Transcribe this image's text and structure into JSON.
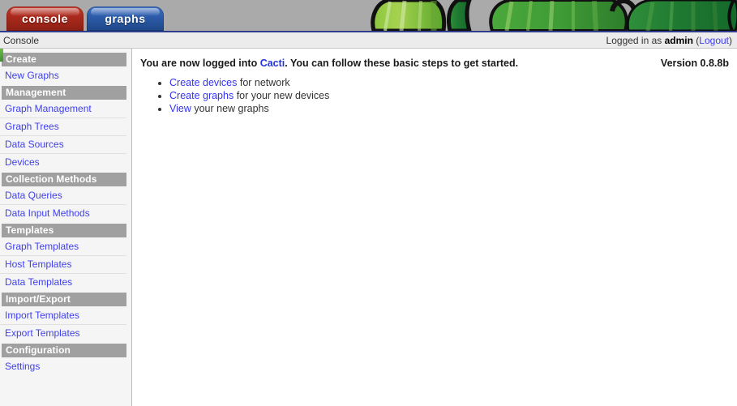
{
  "banner": {
    "art_name": "cacti-logo-banner",
    "background_color": "#aaaaaa"
  },
  "tabs": [
    {
      "id": "console",
      "label": "console",
      "color": "#a82a1d",
      "active": true
    },
    {
      "id": "graphs",
      "label": "graphs",
      "color": "#2b5ba8",
      "active": false
    }
  ],
  "topbar": {
    "breadcrumb": "Console",
    "logged_in_prefix": "Logged in as ",
    "username": "admin",
    "paren_open": " (",
    "logout_label": "Logout",
    "paren_close": ")"
  },
  "sidebar": {
    "sections": [
      {
        "header": "Create",
        "items": [
          {
            "label": "New Graphs",
            "last": true
          }
        ]
      },
      {
        "header": "Management",
        "items": [
          {
            "label": "Graph Management",
            "last": false
          },
          {
            "label": "Graph Trees",
            "last": false
          },
          {
            "label": "Data Sources",
            "last": false
          },
          {
            "label": "Devices",
            "last": true
          }
        ]
      },
      {
        "header": "Collection Methods",
        "items": [
          {
            "label": "Data Queries",
            "last": false
          },
          {
            "label": "Data Input Methods",
            "last": true
          }
        ]
      },
      {
        "header": "Templates",
        "items": [
          {
            "label": "Graph Templates",
            "last": false
          },
          {
            "label": "Host Templates",
            "last": false
          },
          {
            "label": "Data Templates",
            "last": true
          }
        ]
      },
      {
        "header": "Import/Export",
        "items": [
          {
            "label": "Import Templates",
            "last": false
          },
          {
            "label": "Export Templates",
            "last": true
          }
        ]
      },
      {
        "header": "Configuration",
        "items": [
          {
            "label": "Settings",
            "last": true
          }
        ]
      }
    ]
  },
  "main": {
    "welcome": {
      "part1": "You are now logged into ",
      "link": "Cacti",
      "part2": ". You can follow these basic steps to get started."
    },
    "version": "Version 0.8.8b",
    "steps": [
      {
        "link": "Create devices",
        "rest": " for network"
      },
      {
        "link": "Create graphs",
        "rest": " for your new devices"
      },
      {
        "link": "View",
        "rest": " your new graphs"
      }
    ]
  },
  "colors": {
    "accent_red": "#a82a1d",
    "accent_blue": "#2b5ba8",
    "link": "#4040ee",
    "nav_header_bg": "#a0a0a0",
    "sidebar_bg": "#f5f5f5",
    "banner_bg": "#aaaaaa",
    "topbar_bg": "#ececec",
    "topbar_rule": "#2f3e8c"
  }
}
